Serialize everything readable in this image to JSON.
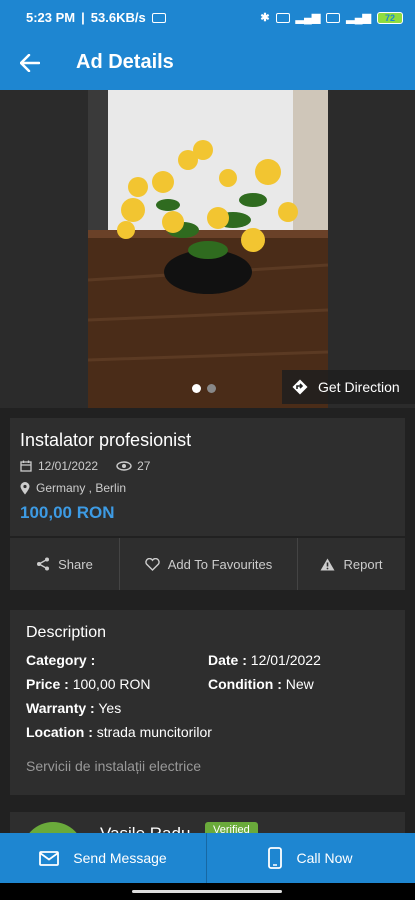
{
  "status_bar": {
    "time": "5:23 PM",
    "speed": "53.6KB/s",
    "battery": "72"
  },
  "appbar": {
    "title": "Ad Details",
    "back_icon": "arrow-left-icon"
  },
  "gallery": {
    "image_count": 2,
    "active_index": 0,
    "get_direction_label": "Get Direction"
  },
  "ad": {
    "title": "Instalator profesionist",
    "date": "12/01/2022",
    "views": "27",
    "location": "Germany , Berlin",
    "price": "100,00 RON"
  },
  "actions": {
    "share": "Share",
    "favourites": "Add To Favourites",
    "report": "Report"
  },
  "description": {
    "heading": "Description",
    "category_label": "Category :",
    "category_value": "",
    "date_label": "Date :",
    "date_value": "12/01/2022",
    "price_label": "Price :",
    "price_value": "100,00 RON",
    "condition_label": "Condition :",
    "condition_value": "New",
    "warranty_label": "Warranty :",
    "warranty_value": "Yes",
    "location_label": "Location :",
    "location_value": "strada muncitorilor",
    "text": "Servicii de instalații electrice"
  },
  "seller": {
    "name": "Vasile Radu",
    "badge": "Verified"
  },
  "bottom_bar": {
    "send_message": "Send Message",
    "call_now": "Call Now"
  },
  "colors": {
    "primary": "#1e86d1",
    "price": "#3d9be4",
    "verified": "#6aaa3b",
    "background": "#212121",
    "card": "#2e2e2e"
  }
}
